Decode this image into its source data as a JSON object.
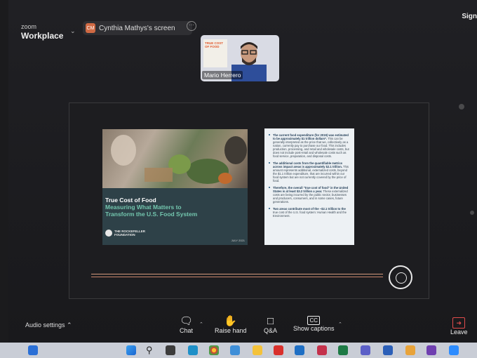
{
  "app": {
    "logo_small": "zoom",
    "logo_main": "Workplace"
  },
  "share": {
    "avatar_initials": "CM",
    "label": "Cynthia Mathys's screen"
  },
  "top_right": {
    "sign_label": "Sign"
  },
  "video_tile": {
    "name": "Mario Herrero",
    "book_text": "TRUE COST OF FOOD"
  },
  "slide_left": {
    "title_line1": "True Cost of Food",
    "title_line2": "Measuring What Matters to",
    "title_line3": "Transform the U.S. Food System",
    "org": "THE ROCKEFELLER FOUNDATION",
    "date": "JULY 2021"
  },
  "slide_right": {
    "bullets": [
      {
        "bold": "The current food expenditure (for 2019) was estimated to be approximately $1 trillion dollars*.",
        "text": " This can be generally interpreted as the price that we, collectively as a nation, currently pay to purchase our food. This includes production, processing, and retail and wholesale costs, but does not include post-retail and wholesale costs such as food service, preparation, and disposal costs."
      },
      {
        "bold": "The additional costs from the quantifiable metrics across impact areas is approximately $2.1 trillion.",
        "text": " This amount represents additional, externalized costs, beyond the $1.1 trillion expenditure, that are incurred within our food system but are not currently covered by the price of food."
      },
      {
        "bold": "Therefore, the overall \"true cost of food\" in the United States is at least $3.2 trillion a year.",
        "text": " These externalized costs are being incurred by the public sector, businesses and producers, consumers, and in some cases, future generations."
      },
      {
        "bold": "Two areas contribute most of the ~$2.1 trillion to the",
        "text": " true cost of the U.S. food system: Human Health and the Environment."
      }
    ]
  },
  "controls": {
    "audio_settings": "Audio settings",
    "chat": "Chat",
    "raise_hand": "Raise hand",
    "qa": "Q&A",
    "show_captions": "Show captions",
    "cc": "CC",
    "leave": "Leave"
  },
  "colors": {
    "accent_teal": "#73c6ae",
    "slide_bg": "#2e4148",
    "leave_red": "#e24c4c"
  }
}
